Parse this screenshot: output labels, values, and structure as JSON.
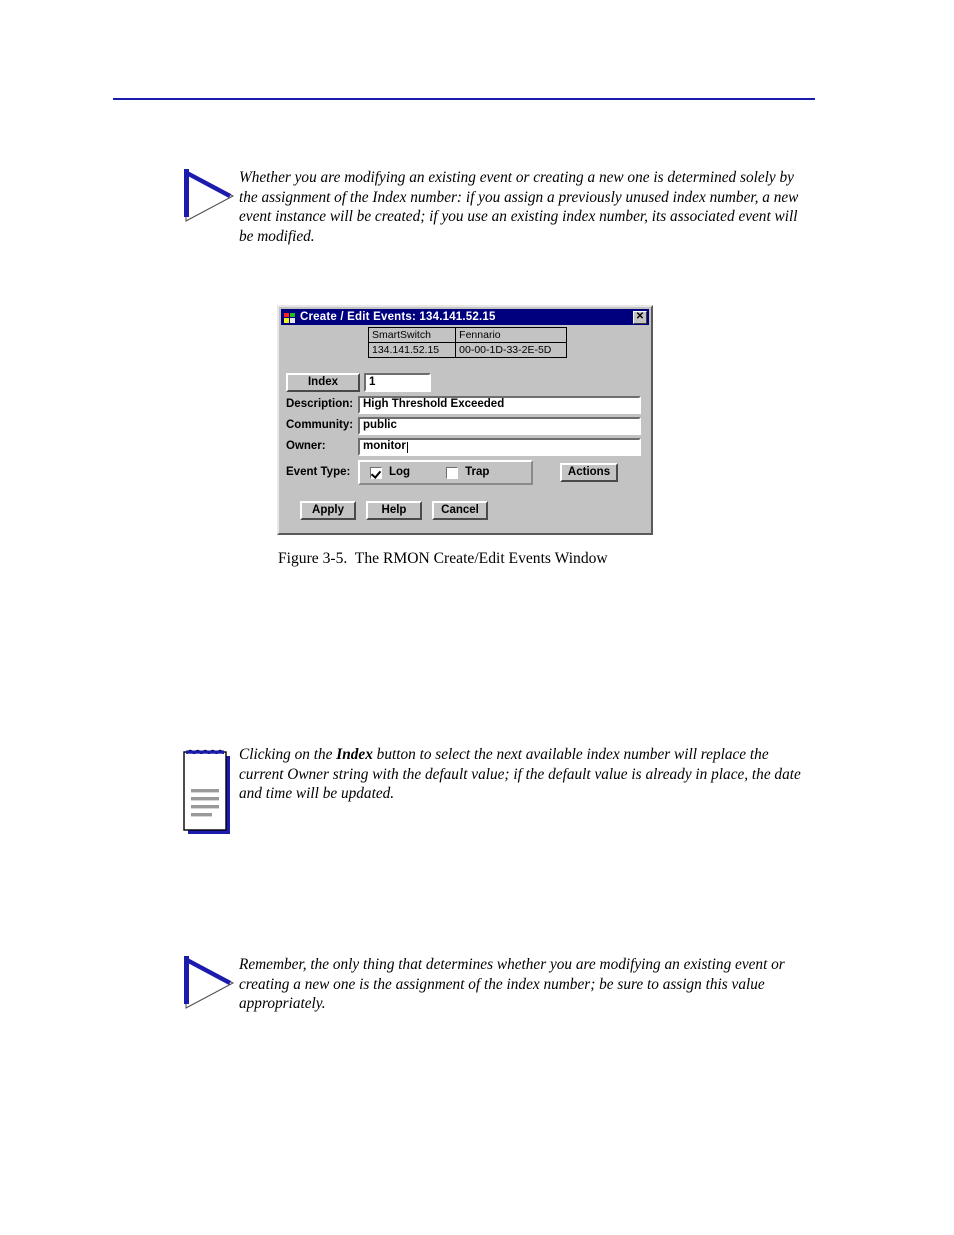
{
  "page": {
    "rule_color": "#1b1bad",
    "figure_caption": "Figure 3-5.  The RMON Create/Edit Events Window"
  },
  "notes": [
    {
      "icon": "tip-triangle-icon",
      "text": "Whether you are modifying an existing event or creating a new one is determined solely by the assignment of the Index number: if you assign a previously unused index number, a new event instance will be created; if you use an existing index number, its associated event will be modified."
    },
    {
      "icon": "notepad-icon",
      "text_before": "Clicking on the ",
      "text_bold": "Index",
      "text_after": " button to select the next available index number will replace the current Owner string with the default value; if the default value is already in place, the date and time will be updated."
    },
    {
      "icon": "tip-triangle-icon",
      "text": "Remember, the only thing that determines whether you are modifying an existing event or creating a new one is the assignment of the index number; be sure to assign this value appropriately."
    }
  ],
  "dialog": {
    "title": "Create / Edit Events: 134.141.52.15",
    "title_bar_color": "#00007e",
    "close_label": "✕",
    "device_table": {
      "headers": [
        "SmartSwitch",
        "Fennario"
      ],
      "values": [
        "134.141.52.15",
        "00-00-1D-33-2E-5D"
      ]
    },
    "index": {
      "button_label": "Index",
      "value": "1"
    },
    "fields": [
      {
        "label": "Description:",
        "value": "High Threshold Exceeded"
      },
      {
        "label": "Community:",
        "value": "public"
      },
      {
        "label": "Owner:",
        "value": "monitor"
      }
    ],
    "event_type": {
      "label": "Event Type:",
      "options": [
        {
          "label": "Log",
          "checked": true
        },
        {
          "label": "Trap",
          "checked": false
        }
      ]
    },
    "actions_button": "Actions",
    "buttons": [
      "Apply",
      "Help",
      "Cancel"
    ]
  }
}
